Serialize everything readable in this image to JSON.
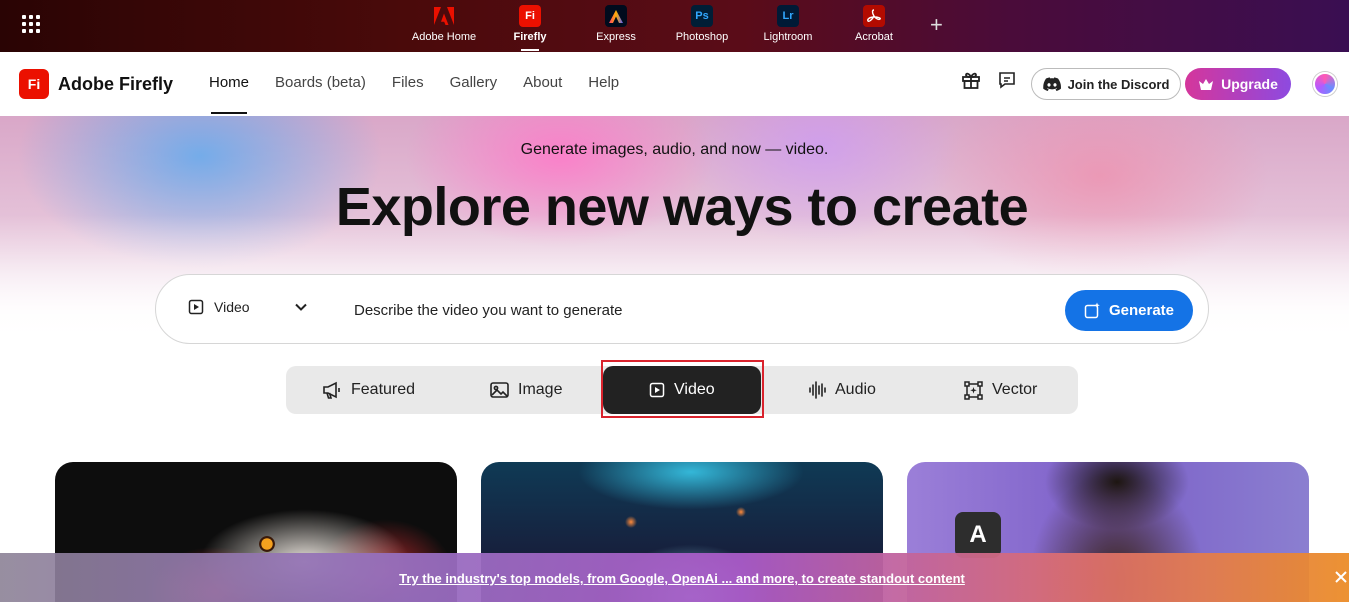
{
  "appbar": {
    "apps": [
      {
        "label": "Adobe Home",
        "glyph": "",
        "color": "#eb1000",
        "active": false
      },
      {
        "label": "Firefly",
        "glyph": "Fi",
        "color": "#eb1000",
        "active": true
      },
      {
        "label": "Express",
        "glyph": "",
        "color": "#000b1d",
        "active": false
      },
      {
        "label": "Photoshop",
        "glyph": "Ps",
        "color": "#001e36",
        "active": false
      },
      {
        "label": "Lightroom",
        "glyph": "Lr",
        "color": "#001a36",
        "active": false
      },
      {
        "label": "Acrobat",
        "glyph": "",
        "color": "#b30b00",
        "active": false
      }
    ]
  },
  "nav": {
    "brand_glyph": "Fi",
    "brand_name": "Adobe Firefly",
    "links": [
      "Home",
      "Boards (beta)",
      "Files",
      "Gallery",
      "About",
      "Help"
    ],
    "active_link": "Home",
    "discord_label": "Join the Discord",
    "upgrade_label": "Upgrade"
  },
  "hero": {
    "subtitle": "Generate images, audio, and now — video.",
    "title": "Explore new ways to create"
  },
  "prompt": {
    "mode": "Video",
    "placeholder": "Describe the video you want to generate",
    "generate_label": "Generate"
  },
  "tabs": {
    "items": [
      "Featured",
      "Image",
      "Video",
      "Audio",
      "Vector"
    ],
    "active": "Video"
  },
  "cards": {
    "card3_badge": "A"
  },
  "banner": {
    "text": "Try the industry's top models, from Google, OpenAi ... and more, to create standout content"
  },
  "colors": {
    "brand_red": "#eb1000",
    "generate_blue": "#1473e6",
    "active_tab": "#222222"
  }
}
